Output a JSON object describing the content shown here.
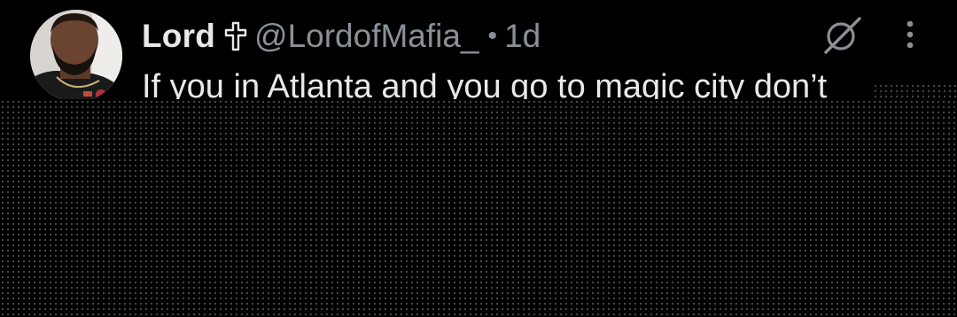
{
  "tweet": {
    "display_name": "Lord",
    "handle": "@LordofMafia_",
    "separator": "•",
    "timestamp": "1d",
    "text": "If you in Atlanta and you go to magic city don’t"
  },
  "icons": {
    "name_badge": "latin-cross-icon",
    "grok": "grok-icon",
    "more": "more-vertical-icon"
  },
  "colors": {
    "background": "#000000",
    "primary_text": "#e7e9ea",
    "secondary_text": "#8b9096"
  }
}
